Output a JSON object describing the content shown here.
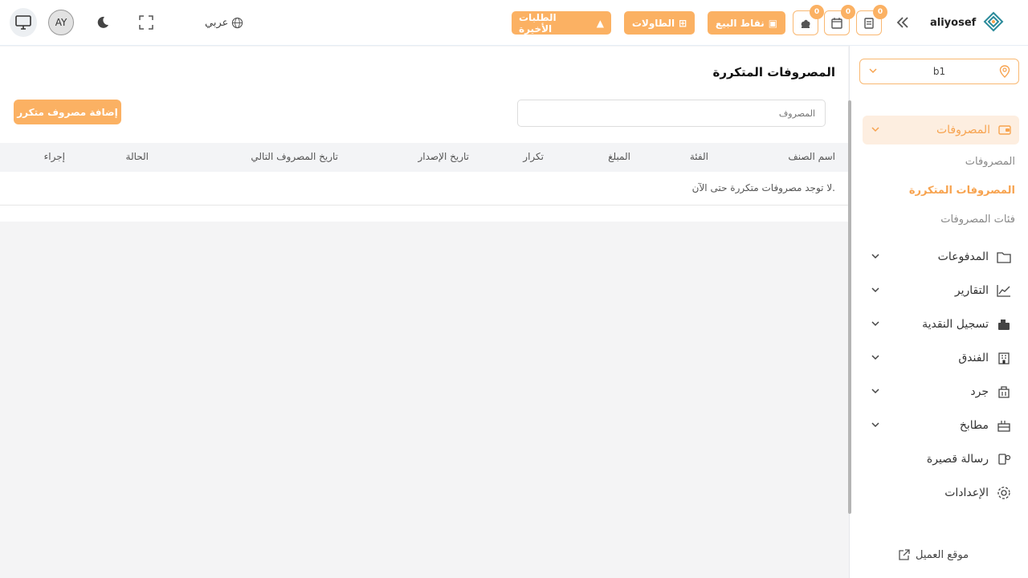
{
  "header": {
    "brand_name": "aliyosef",
    "badges": {
      "pos_orders": "0",
      "reservations": "0",
      "kitchen": "0"
    },
    "pills": {
      "pos": "نقاط البيع",
      "tables": "الطاولات",
      "recent_orders": "الطلبات الأخيرة"
    },
    "language": "عربي",
    "avatar_initials": "AY"
  },
  "sidebar": {
    "branch": "b1",
    "active_group": "المصروفات",
    "sub_items": [
      "المصروفات",
      "المصروفات المتكررة",
      "فئات المصروفات"
    ],
    "items": [
      {
        "label": "المدفوعات",
        "icon": "wallet-icon"
      },
      {
        "label": "التقارير",
        "icon": "chart-icon"
      },
      {
        "label": "تسجيل النقدية",
        "icon": "cash-register-icon"
      },
      {
        "label": "الفندق",
        "icon": "hotel-icon"
      },
      {
        "label": "جرد",
        "icon": "inventory-icon"
      },
      {
        "label": "مطابخ",
        "icon": "kitchen-icon"
      },
      {
        "label": "رسالة قصيرة",
        "icon": "sms-icon"
      },
      {
        "label": "الإعدادات",
        "icon": "gear-icon"
      }
    ],
    "client_site": "موقع العميل"
  },
  "main": {
    "title": "المصروفات المتكررة",
    "add_button": "إضافة مصروف متكرر",
    "search_placeholder": "المصروف",
    "columns": [
      "اسم الصنف",
      "الفئة",
      "المبلغ",
      "تكرار",
      "تاريخ الإصدار",
      "تاريخ المصروف التالي",
      "الحالة",
      "إجراء"
    ],
    "empty_message": "لا توجد مصروفات متكررة حتى الآن."
  },
  "colors": {
    "accent": "#fbb163",
    "accent_text": "#f7a34f",
    "active_bg": "#fdeee0"
  }
}
